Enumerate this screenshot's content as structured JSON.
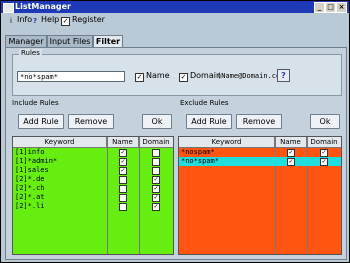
{
  "window": {
    "title": "ListManager",
    "btn_min": "_",
    "btn_max": "□",
    "btn_close": "×"
  },
  "menu": {
    "info": "Info",
    "help": "Help",
    "register": "Register",
    "register_checked": "✓"
  },
  "tabs": [
    "Manager",
    "Input Files",
    "Filter"
  ],
  "rules": {
    "legend": "Rules",
    "value": "*no*spam*",
    "name_label": "Name",
    "domain_label": "Domain",
    "domain_hint": "(Name@Domain.com)",
    "name_checked": "✓",
    "domain_checked": "✓",
    "help": "?"
  },
  "include": {
    "label": "Include Rules",
    "add": "Add Rule",
    "remove": "Remove",
    "ok": "Ok",
    "columns": [
      "Keyword",
      "Name",
      "Domain"
    ],
    "rows": [
      {
        "keyword": "[1]info",
        "name": "✓",
        "domain": ""
      },
      {
        "keyword": "[1]*admin*",
        "name": "✓",
        "domain": ""
      },
      {
        "keyword": "[1]sales",
        "name": "✓",
        "domain": ""
      },
      {
        "keyword": "[2]*.de",
        "name": "",
        "domain": "✓"
      },
      {
        "keyword": "[2]*.ch",
        "name": "",
        "domain": "✓"
      },
      {
        "keyword": "[2]*.at",
        "name": "",
        "domain": "✓"
      },
      {
        "keyword": "[2]*.li",
        "name": "",
        "domain": "✓"
      }
    ],
    "color": "#66ee11"
  },
  "exclude": {
    "label": "Exclude Rules",
    "add": "Add Rule",
    "remove": "Remove",
    "ok": "Ok",
    "columns": [
      "Keyword",
      "Name",
      "Domain"
    ],
    "rows": [
      {
        "keyword": "*nospam*",
        "name": "✓",
        "domain": "✓"
      },
      {
        "keyword": "*no*spam*",
        "name": "✓",
        "domain": "✓"
      }
    ],
    "color": "#ff5511",
    "selected_color": "#22dddd"
  }
}
